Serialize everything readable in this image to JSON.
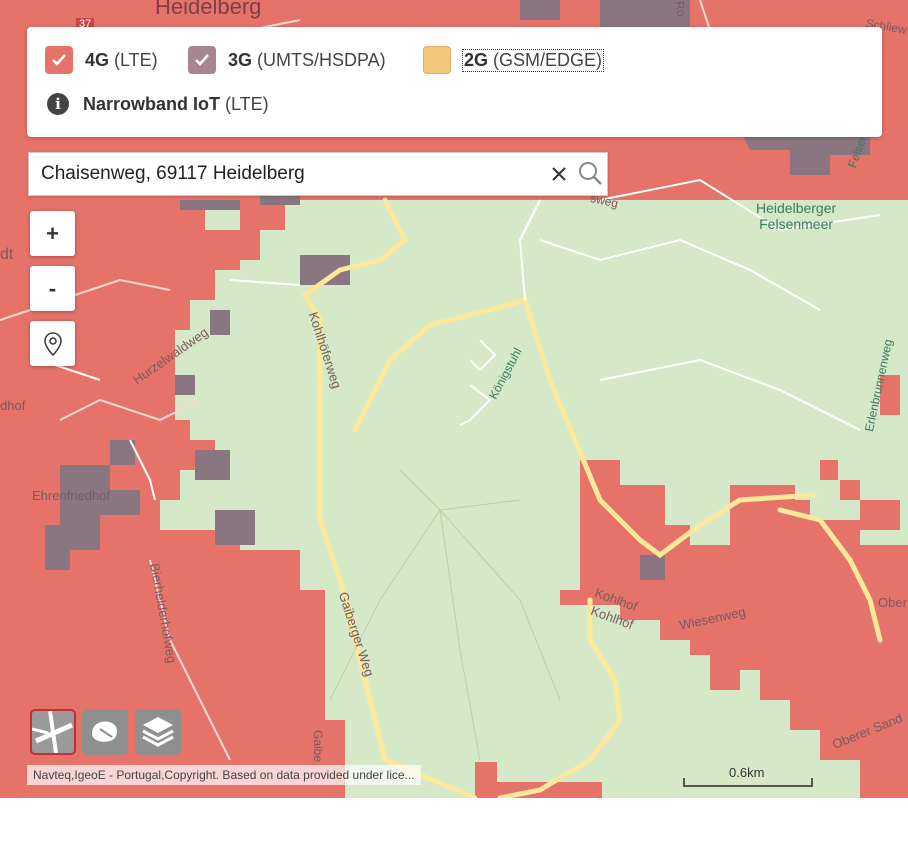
{
  "legend": {
    "items": [
      {
        "name": "4G",
        "detail": "(LTE)",
        "checked": true,
        "color": "#e5736a"
      },
      {
        "name": "3G",
        "detail": "(UMTS/HSDPA)",
        "checked": true,
        "color": "#a88592"
      },
      {
        "name": "2G",
        "detail": "(GSM/EDGE)",
        "checked": false,
        "color": "#f2c77c"
      }
    ],
    "iot": {
      "name": "Narrowband IoT",
      "detail": "(LTE)"
    }
  },
  "search": {
    "value": "Chaisenweg, 69117 Heidelberg"
  },
  "zoom": {
    "in_label": "+",
    "out_label": "-"
  },
  "map_labels": {
    "heidelberg": "Heidelberg",
    "dt": "dt",
    "felsenmeer": "Heidelberger\nFelsenmeer",
    "felsenmeer_a": "Felsenmeer-A",
    "hurzelwaldweg": "Hurzelwaldweg",
    "kohlhoferweg": "Kohlhöferweg",
    "koenigstuhl": "Königstuhl",
    "erlenbrunnenweg": "Erlenbrunnenweg",
    "ehrenfriedhof": "Ehrenfriedhof",
    "hof": "dhof",
    "bierhelderhofweg": "Bierhelderhofweg",
    "gaiberger_weg": "Gaiberger Weg",
    "gaibe": "Gaibe",
    "kohlhof1": "Kohlhof",
    "kohlhof2": "Kohlhof",
    "wiesenweg": "Wiesenweg",
    "ober": "Ober",
    "oberer_sand": "Oberer Sand",
    "sweg": "sweg",
    "schliew": "Schliew",
    "ro": "Ro",
    "road_number": "37"
  },
  "attribution": "Navteq,IgeoE - Portugal,Copyright. Based on data provided under lice...",
  "scale": {
    "label": "0.6km"
  },
  "colors": {
    "map_green": "#d5e8c8",
    "coverage_4g": "#e5736a",
    "coverage_3g": "#8a7680",
    "road_yellow": "#fbe89a"
  }
}
